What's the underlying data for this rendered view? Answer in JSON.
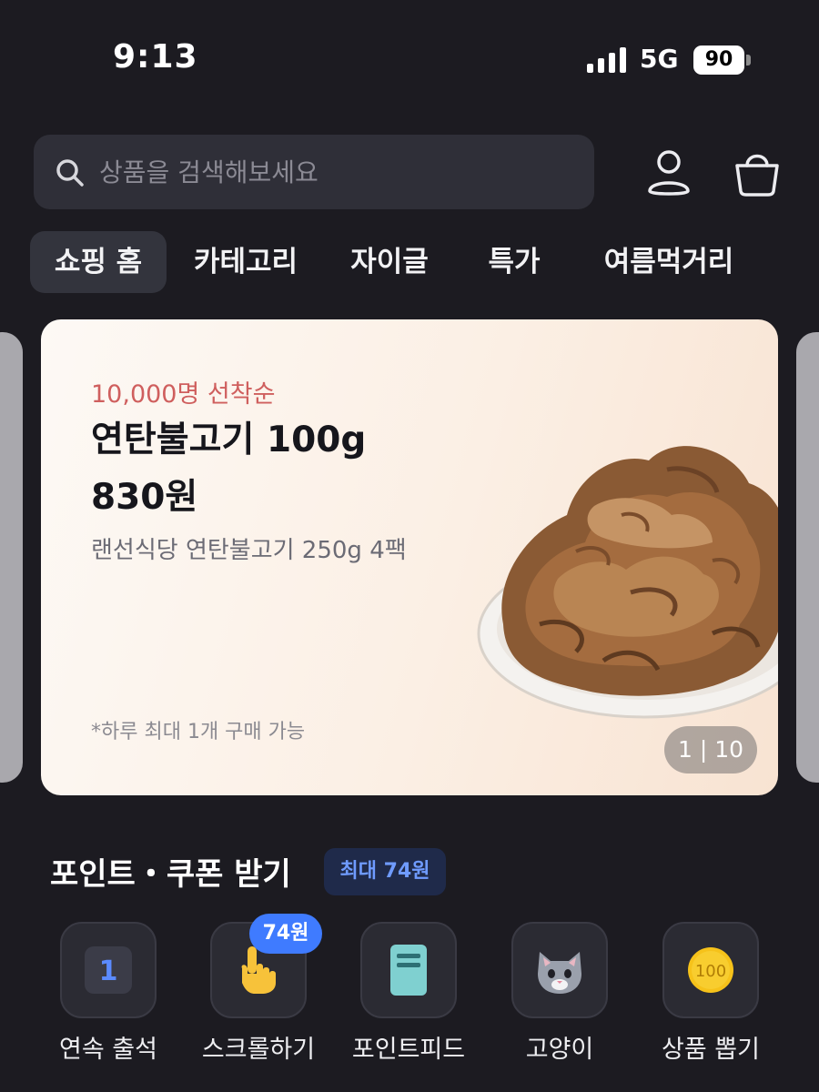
{
  "status_bar": {
    "time": "9:13",
    "network": "5G",
    "battery": "90"
  },
  "search": {
    "placeholder": "상품을 검색해보세요"
  },
  "tabs": [
    {
      "label": "쇼핑 홈",
      "active": true
    },
    {
      "label": "카테고리"
    },
    {
      "label": "자이글"
    },
    {
      "label": "특가"
    },
    {
      "label": "여름먹거리"
    }
  ],
  "banner": {
    "tag": "10,000명 선착순",
    "title": "연탄불고기 100g",
    "price": "830원",
    "description": "랜선식당 연탄불고기 250g 4팩",
    "note": "*하루 최대 1개 구매 가능",
    "counter": "1 | 10"
  },
  "points": {
    "title": "포인트・쿠폰 받기",
    "badge": "최대 74원",
    "items": [
      {
        "label": "연속 출석",
        "icon": "calendar-day-icon",
        "icon_text": "1"
      },
      {
        "label": "스크롤하기",
        "icon": "pointing-hand-icon",
        "bubble": "74원"
      },
      {
        "label": "포인트피드",
        "icon": "feed-note-icon"
      },
      {
        "label": "고양이",
        "icon": "cat-face-icon"
      },
      {
        "label": "상품 뽑기",
        "icon": "coin-icon",
        "icon_text": "100"
      }
    ]
  },
  "colors": {
    "background": "#1c1b21",
    "accent_blue": "#3f7bff",
    "tag_red": "#cf5f5e",
    "coin_yellow": "#f6c21a"
  }
}
